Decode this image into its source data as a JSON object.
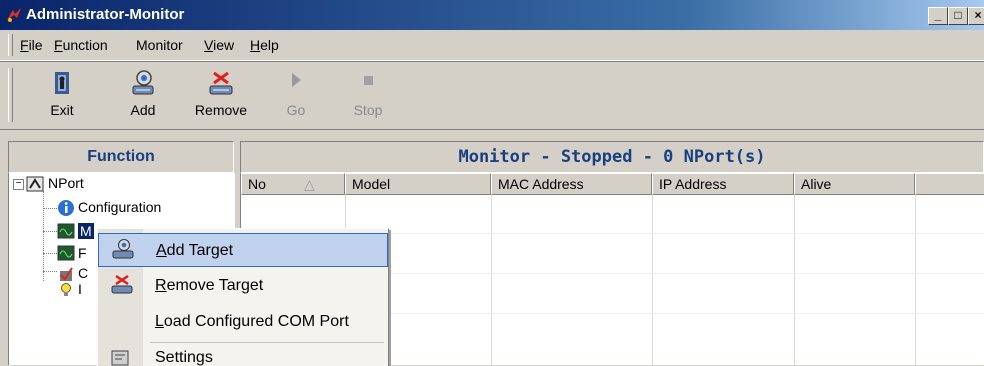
{
  "window": {
    "title": "Administrator-Monitor",
    "caption_buttons": [
      "_",
      "□",
      "×"
    ]
  },
  "menu": [
    "File",
    "Function",
    "Monitor",
    "View",
    "Help"
  ],
  "toolbar": {
    "buttons": [
      {
        "label": "Exit",
        "icon": "exit-icon",
        "enabled": true
      },
      {
        "label": "Add",
        "icon": "add-target-icon",
        "enabled": true
      },
      {
        "label": "Remove",
        "icon": "remove-target-icon",
        "enabled": true
      },
      {
        "label": "Go",
        "icon": "play-icon",
        "enabled": false
      },
      {
        "label": "Stop",
        "icon": "stop-icon",
        "enabled": false
      }
    ]
  },
  "function_panel": {
    "title": "Function",
    "tree": {
      "root": "NPort",
      "children": [
        {
          "label": "Configuration",
          "icon": "info-icon"
        },
        {
          "label": "M",
          "icon": "monitor-icon"
        },
        {
          "label": "F",
          "icon": "monitor-icon"
        },
        {
          "label": "C",
          "icon": "port-icon"
        },
        {
          "label": "I",
          "icon": "bulb-icon"
        }
      ]
    }
  },
  "monitor_panel": {
    "title": "Monitor - Stopped - 0 NPort(s)",
    "columns": [
      "No",
      "Model",
      "MAC Address",
      "IP Address",
      "Alive"
    ],
    "sort_indicator": "△",
    "rows": []
  },
  "context_menu": {
    "items": [
      {
        "label": "Add Target",
        "icon": "add-target-icon",
        "highlighted": true
      },
      {
        "label": "Remove Target",
        "icon": "remove-target-icon",
        "highlighted": false
      },
      {
        "label": "Load Configured COM Port",
        "icon": "",
        "highlighted": false
      },
      {
        "label": "Settings",
        "icon": "settings-icon",
        "highlighted": false
      }
    ]
  },
  "colors": {
    "title_start": "#0a246a",
    "title_end": "#a6caf0",
    "panel_title": "#1a3f7f",
    "highlight": "#c1d2ee"
  }
}
